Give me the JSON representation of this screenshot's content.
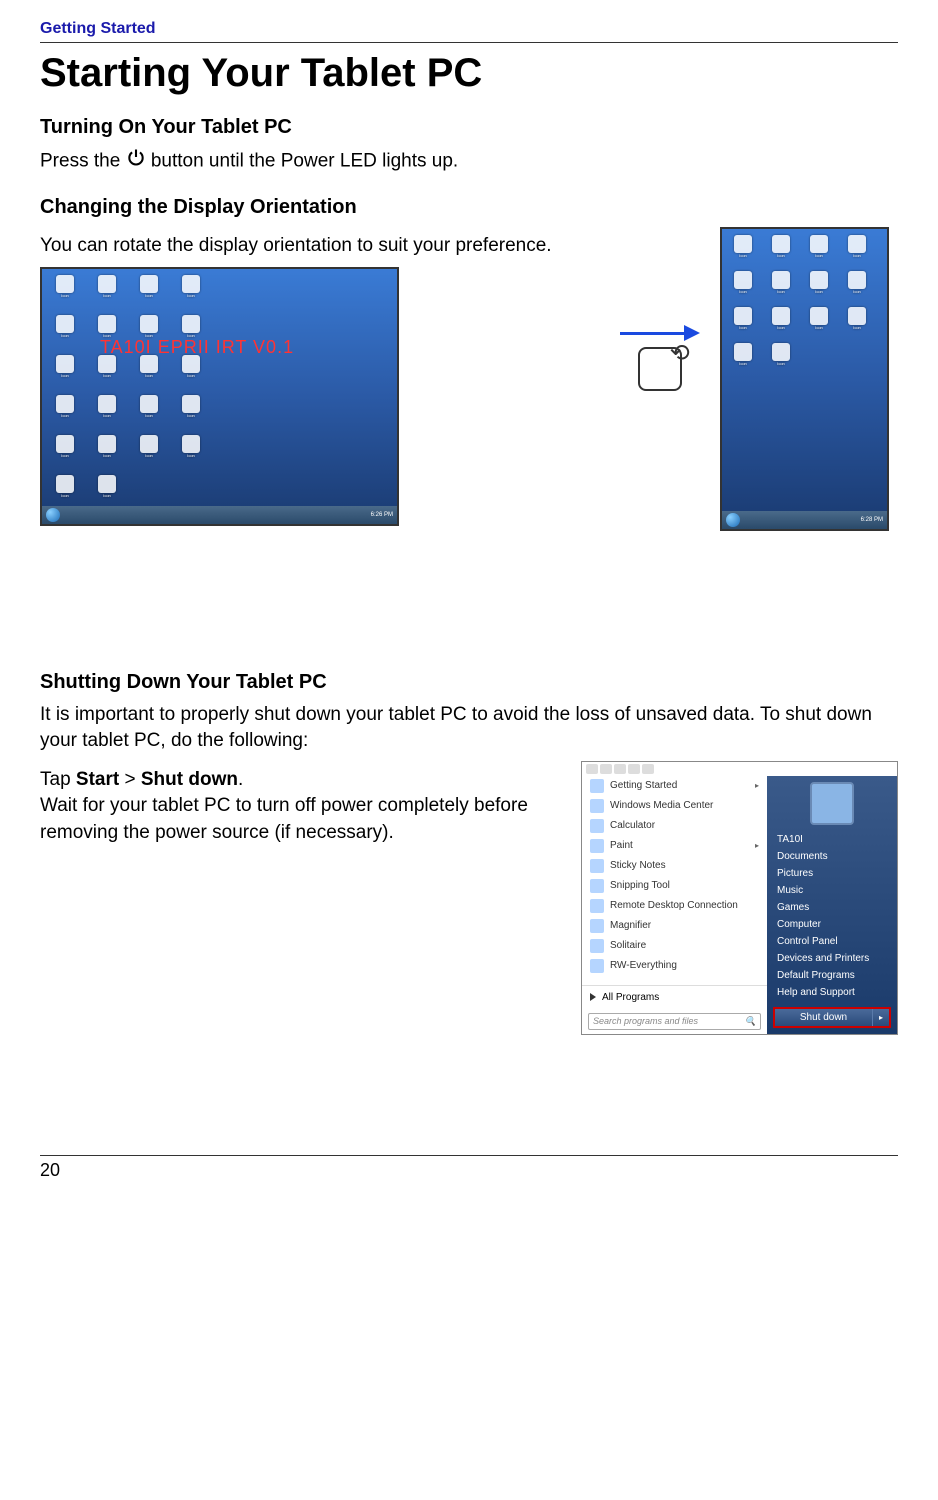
{
  "header": {
    "section": "Getting Started"
  },
  "title": "Starting Your Tablet PC",
  "s1": {
    "heading": "Turning On Your Tablet PC",
    "text_before": "Press the ",
    "text_after": " button until the Power LED lights up."
  },
  "s2": {
    "heading": "Changing the Display Orientation",
    "text": "You can rotate the display orientation to suit your preference.",
    "watermark": "TA10I EPRII IRT V0.1",
    "clock_landscape": "6:26 PM",
    "clock_portrait": "6:28 PM"
  },
  "s3": {
    "heading": "Shutting Down Your Tablet PC",
    "intro": "It is important to properly shut down your tablet PC to avoid the loss of unsaved data. To shut down your tablet PC, do the following:",
    "tap": "Tap ",
    "start": "Start",
    "gt": " > ",
    "shutdown": "Shut down",
    "period": ".",
    "wait": "Wait for your tablet PC to turn off power completely before removing the power source (if necessary)."
  },
  "startmenu": {
    "programs": [
      "Getting Started",
      "Windows Media Center",
      "Calculator",
      "Paint",
      "Sticky Notes",
      "Snipping Tool",
      "Remote Desktop Connection",
      "Magnifier",
      "Solitaire",
      "RW-Everything"
    ],
    "submenu_indices": [
      0,
      3
    ],
    "all_programs": "All Programs",
    "search_placeholder": "Search programs and files",
    "right_links": [
      "TA10I",
      "Documents",
      "Pictures",
      "Music",
      "Games",
      "Computer",
      "Control Panel",
      "Devices and Printers",
      "Default Programs",
      "Help and Support"
    ],
    "shutdown_label": "Shut down"
  },
  "page_number": "20"
}
